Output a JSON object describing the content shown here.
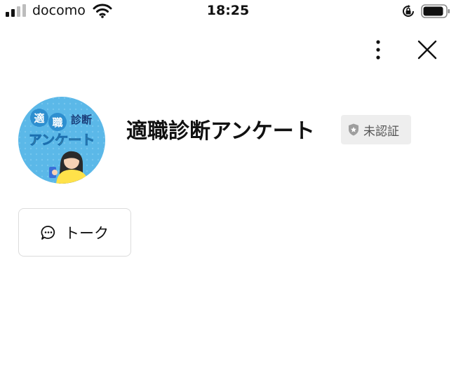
{
  "status_bar": {
    "carrier": "docomo",
    "time": "18:25",
    "icons": [
      "signal-icon",
      "wifi-icon",
      "orientation-lock-icon",
      "battery-icon"
    ]
  },
  "nav": {
    "icons": [
      "more-vertical-icon",
      "close-icon"
    ]
  },
  "profile": {
    "name": "適職診断アンケート",
    "badge": "未認証",
    "avatar_lines": [
      "適",
      "職",
      "診断",
      "アンケート"
    ]
  },
  "actions": {
    "talk_label": "トーク"
  },
  "colors": {
    "avatar_bg": "#5bb8e8",
    "avatar_text": "#ffffff",
    "avatar_accent": "#ffe24a",
    "badge_bg": "#eeeeee"
  }
}
